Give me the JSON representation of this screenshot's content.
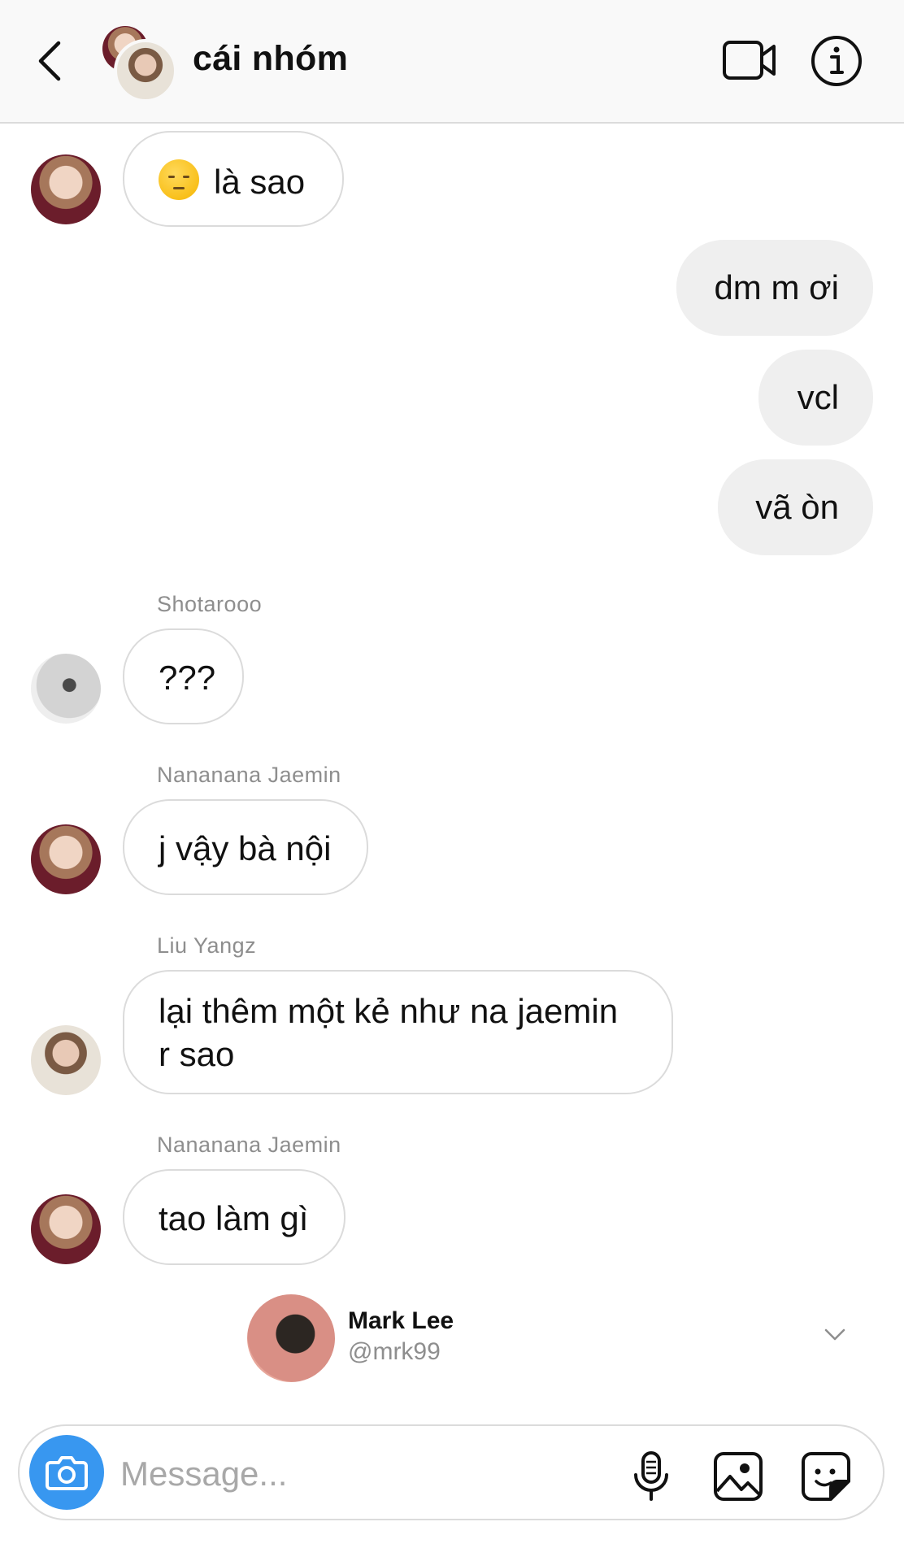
{
  "header": {
    "title": "cái nhóm",
    "back_icon": "chevron-left-icon",
    "video_icon": "video-camera-icon",
    "info_icon": "info-icon"
  },
  "messages": [
    {
      "direction": "in",
      "sender": "",
      "emoji": "pensive-face",
      "text": "là sao",
      "show_avatar": true
    },
    {
      "direction": "out",
      "text": "dm m ơi"
    },
    {
      "direction": "out",
      "text": "vcl"
    },
    {
      "direction": "out",
      "text": "vã òn"
    },
    {
      "direction": "in",
      "sender": "Shotarooo",
      "text": "???",
      "show_avatar": true
    },
    {
      "direction": "in",
      "sender": "Nananana Jaemin",
      "text": "j vậy bà nội",
      "show_avatar": true
    },
    {
      "direction": "in",
      "sender": "Liu Yangz",
      "text_line1": "lại thêm một kẻ như na jaemin",
      "text_line2": "r sao",
      "show_avatar": true
    },
    {
      "direction": "in",
      "sender": "Nananana Jaemin",
      "text": "tao làm gì",
      "show_avatar": true
    }
  ],
  "shared_profile": {
    "name": "Mark Lee",
    "handle": "@mrk99"
  },
  "composer": {
    "placeholder": "Message...",
    "camera_icon": "camera-icon",
    "mic_icon": "microphone-icon",
    "gallery_icon": "image-icon",
    "sticker_icon": "sticker-icon"
  },
  "colors": {
    "accent": "#3897f0",
    "bubble_outgoing": "#efefef",
    "border": "#dbdbdb",
    "secondary_text": "#8e8e8e"
  }
}
